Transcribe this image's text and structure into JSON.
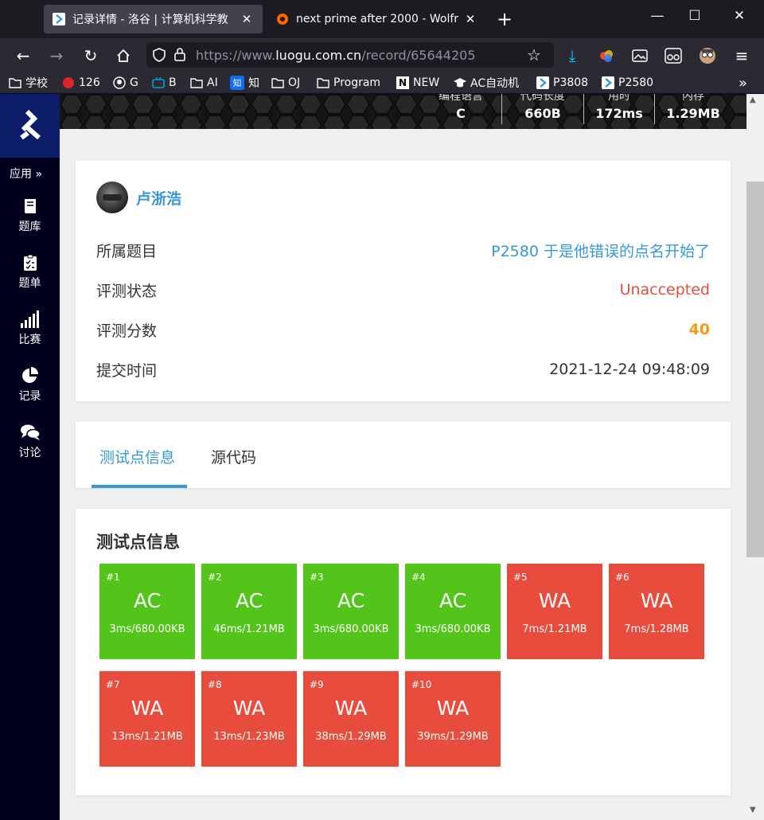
{
  "browser": {
    "tabs": [
      {
        "title": "记录详情 - 洛谷 | 计算机科学教",
        "active": true
      },
      {
        "title": "next prime after 2000 - Wolfr",
        "active": false
      }
    ],
    "url_scheme": "https://www.",
    "url_host": "luogu.com.cn",
    "url_path": "/record/65644205",
    "bookmarks": [
      "学校",
      "126",
      "G",
      "B",
      "AI",
      "知",
      "OJ",
      "Program",
      "NEW",
      "AC自动机",
      "P3808",
      "P2580"
    ]
  },
  "sidebar": {
    "app_label": "应用 »",
    "items": [
      {
        "label": "题库",
        "icon": "book-icon"
      },
      {
        "label": "题单",
        "icon": "clipboard-icon"
      },
      {
        "label": "比赛",
        "icon": "signal-bars-icon"
      },
      {
        "label": "记录",
        "icon": "pie-chart-icon"
      },
      {
        "label": "讨论",
        "icon": "chat-bubbles-icon"
      }
    ]
  },
  "banner": {
    "stats": [
      {
        "label": "编程语言",
        "value": "C"
      },
      {
        "label": "代码长度",
        "value": "660B"
      },
      {
        "label": "用时",
        "value": "172ms"
      },
      {
        "label": "内存",
        "value": "1.29MB"
      }
    ]
  },
  "record": {
    "username": "卢浙浩",
    "problem_label": "所属题目",
    "problem_value": "P2580 于是他错误的点名开始了",
    "status_label": "评测状态",
    "status_value": "Unaccepted",
    "score_label": "评测分数",
    "score_value": "40",
    "time_label": "提交时间",
    "time_value": "2021-12-24 09:48:09"
  },
  "page_tabs": [
    {
      "label": "测试点信息",
      "active": true
    },
    {
      "label": "源代码",
      "active": false
    }
  ],
  "tests": {
    "title": "测试点信息",
    "colors": {
      "AC": "#52c41a",
      "WA": "#e74c3c"
    },
    "cases": [
      {
        "num": "#1",
        "result": "AC",
        "meta": "3ms/680.00KB"
      },
      {
        "num": "#2",
        "result": "AC",
        "meta": "46ms/1.21MB"
      },
      {
        "num": "#3",
        "result": "AC",
        "meta": "3ms/680.00KB"
      },
      {
        "num": "#4",
        "result": "AC",
        "meta": "3ms/680.00KB"
      },
      {
        "num": "#5",
        "result": "WA",
        "meta": "7ms/1.21MB"
      },
      {
        "num": "#6",
        "result": "WA",
        "meta": "7ms/1.28MB"
      },
      {
        "num": "#7",
        "result": "WA",
        "meta": "13ms/1.21MB"
      },
      {
        "num": "#8",
        "result": "WA",
        "meta": "13ms/1.23MB"
      },
      {
        "num": "#9",
        "result": "WA",
        "meta": "38ms/1.29MB"
      },
      {
        "num": "#10",
        "result": "WA",
        "meta": "39ms/1.29MB"
      }
    ]
  }
}
